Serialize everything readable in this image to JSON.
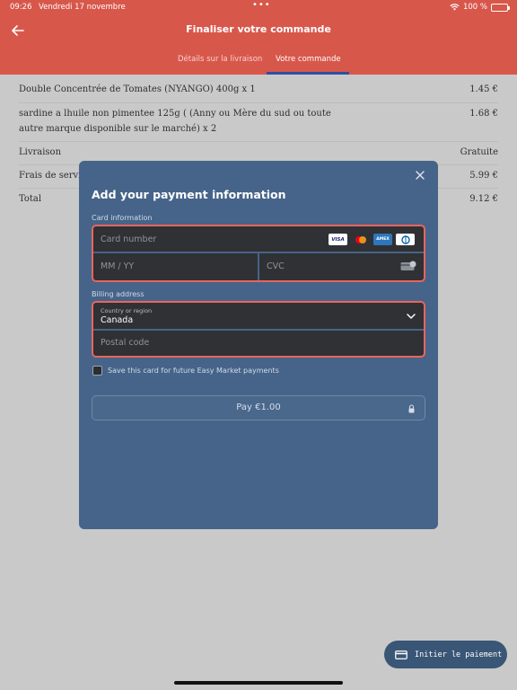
{
  "status_bar": {
    "time": "09:26",
    "date": "Vendredi 17 novembre",
    "dots": "•••",
    "battery": "100 %"
  },
  "header": {
    "title": "Finaliser votre commande",
    "tabs": [
      {
        "label": "Détails sur la livraison"
      },
      {
        "label": "Votre commande"
      }
    ],
    "accent_color": "#d8574b"
  },
  "order": {
    "items": [
      {
        "label": "Double Concentrée  de Tomates  (NYANGO) 400g x 1",
        "amount": "1.45 €"
      },
      {
        "label_line1": "sardine a lhuile non pimentee 125g ( (Anny ou Mère du sud ou toute",
        "label_line2": "autre marque disponible sur le marché) x 2",
        "amount": "1.68 €"
      }
    ],
    "delivery": {
      "label": "Livraison",
      "amount": "Gratuite"
    },
    "service": {
      "label": "Frais de service",
      "amount": "5.99 €"
    },
    "total": {
      "label": "Total",
      "amount": "9.12 €"
    }
  },
  "payment_modal": {
    "title": "Add your payment information",
    "card_section_label": "Card information",
    "card_number_placeholder": "Card number",
    "expiry_placeholder": "MM / YY",
    "cvc_placeholder": "CVC",
    "card_brands": [
      "VISA",
      "mastercard",
      "AMEX",
      "diners"
    ],
    "billing_section_label": "Billing address",
    "country_label": "Country or region",
    "country_value": "Canada",
    "postal_placeholder": "Postal code",
    "save_card_label": "Save this card for future Easy Market payments",
    "pay_label": "Pay €1.00",
    "error_border_color": "#e9655c"
  },
  "floating_button": {
    "label": "Initier le paiement"
  }
}
